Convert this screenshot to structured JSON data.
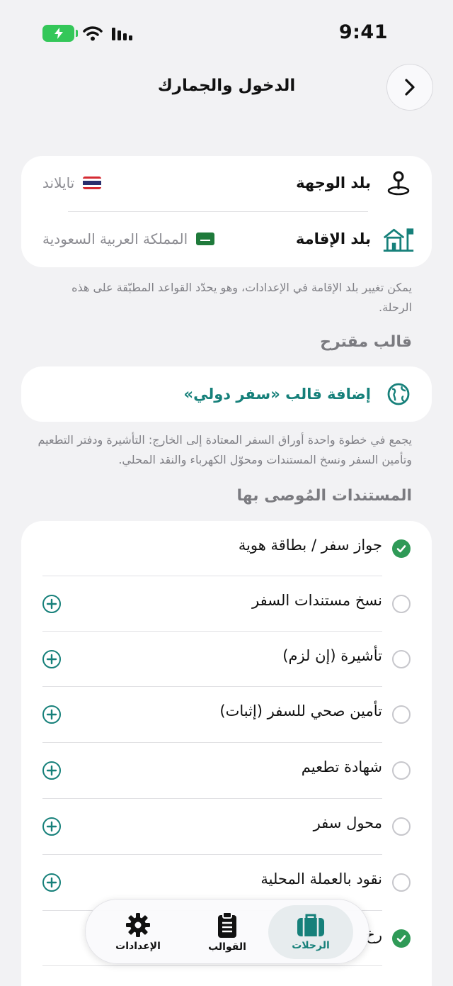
{
  "status": {
    "time": "9:41"
  },
  "header": {
    "title": "الدخول والجمارك"
  },
  "countries": {
    "destination": {
      "label": "بلد الوجهة",
      "value": "تايلاند"
    },
    "residence": {
      "label": "بلد الإقامة",
      "value": "المملكة العربية السعودية"
    }
  },
  "residence_note": "يمكن تغيير بلد الإقامة في الإعدادات، وهو يحدّد القواعد المطبّقة على هذه الرحلة.",
  "suggested": {
    "title": "قالب مقترح",
    "action": "إضافة قالب «سفر دولي»",
    "note": "يجمع في خطوة واحدة أوراق السفر المعتادة إلى الخارج: التأشيرة ودفتر التطعيم وتأمين السفر ونسخ المستندات ومحوّل الكهرباء والنقد المحلي."
  },
  "documents": {
    "title": "المستندات المُوصى بها",
    "items": [
      {
        "label": "جواز سفر / بطاقة هوية",
        "checked": true
      },
      {
        "label": "نسخ مستندات السفر",
        "checked": false
      },
      {
        "label": "تأشيرة (إن لزم)",
        "checked": false
      },
      {
        "label": "تأمين صحي للسفر (إثبات)",
        "checked": false
      },
      {
        "label": "شهادة تطعيم",
        "checked": false
      },
      {
        "label": "محول سفر",
        "checked": false
      },
      {
        "label": "نقود بالعملة المحلية",
        "checked": false
      },
      {
        "label": "رخ",
        "checked": true
      }
    ]
  },
  "tabs": [
    {
      "label": "الرحلات",
      "icon": "suitcase-icon",
      "active": true
    },
    {
      "label": "القوالب",
      "icon": "clipboard-icon",
      "active": false
    },
    {
      "label": "الإعدادات",
      "icon": "gear-icon",
      "active": false
    }
  ],
  "colors": {
    "accent": "#16807a",
    "check": "#2f9a57",
    "battery": "#34c759"
  }
}
